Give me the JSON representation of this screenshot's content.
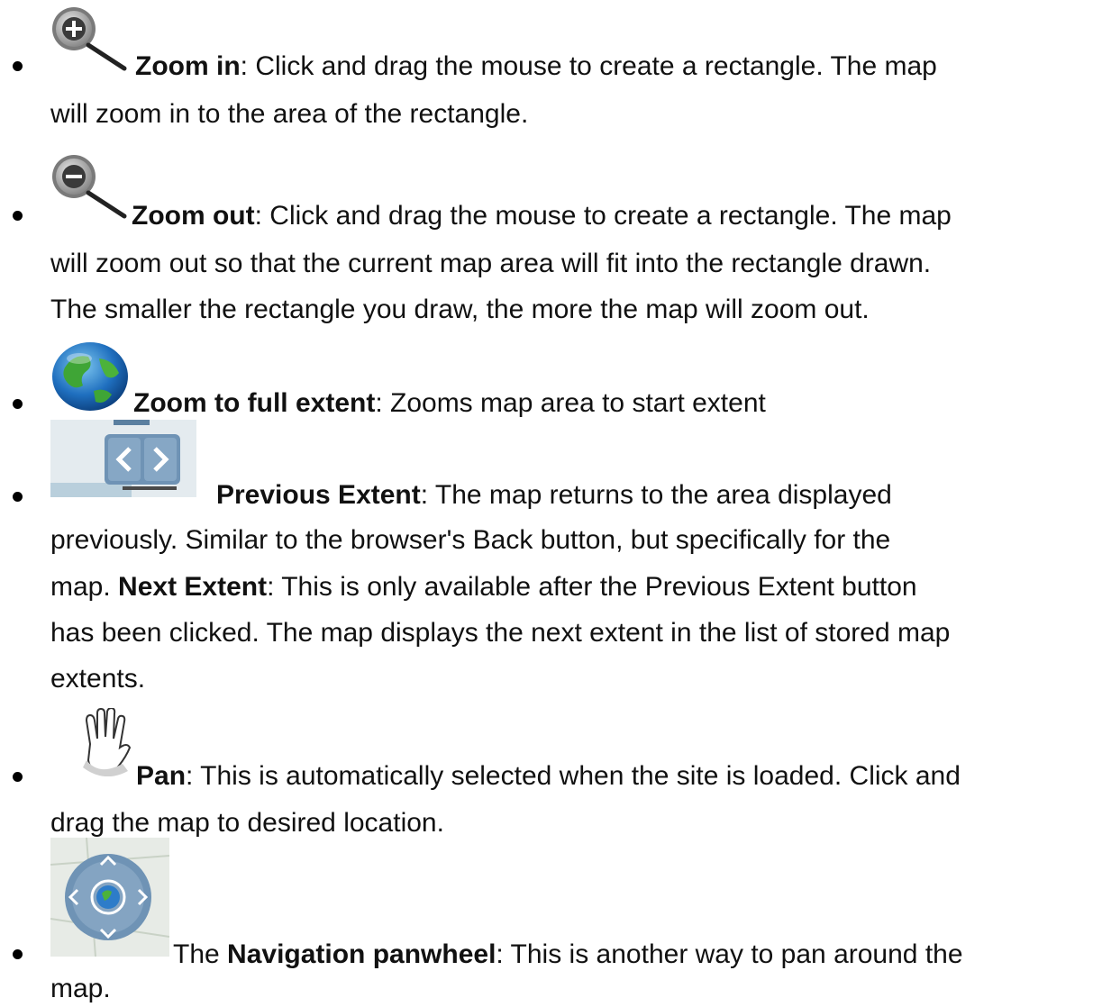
{
  "items": [
    {
      "icon": "zoom-in-icon",
      "title": "Zoom in",
      "line1_rest": ": Click and drag the mouse to create a rectangle. The map",
      "line2": "will zoom in to the area of the rectangle."
    },
    {
      "icon": "zoom-out-icon",
      "title": "Zoom out",
      "line1_rest": ":  Click and drag the mouse to create a rectangle. The map",
      "line2": "will zoom out so that the current map area will fit into the rectangle drawn.",
      "line3": "The smaller the rectangle you draw, the more the map will zoom out."
    },
    {
      "icon": "globe-icon",
      "title": "Zoom to full extent",
      "line1_rest": ":  Zooms map area to start extent"
    },
    {
      "icon": "previous-next-extent-icon",
      "title": "Previous Extent",
      "line1_rest": ": The map returns to the area displayed",
      "line2": "previously. Similar to the browser's Back button, but specifically for the",
      "line3_pre": "map. ",
      "line3_bold": "Next Extent",
      "line3_rest": ": This is only available after the Previous Extent button",
      "line4": "has been clicked. The map displays the next extent in the list of stored map",
      "line5": "extents."
    },
    {
      "icon": "hand-icon",
      "title": "Pan",
      "line1_rest": ": This is automatically selected when the site is loaded. Click and",
      "line2": "drag the map to desired location."
    },
    {
      "icon": "panwheel-icon",
      "pre": "The ",
      "title": "Navigation panwheel",
      "line1_rest": ": This is another way to pan around the",
      "line2": "map."
    }
  ]
}
